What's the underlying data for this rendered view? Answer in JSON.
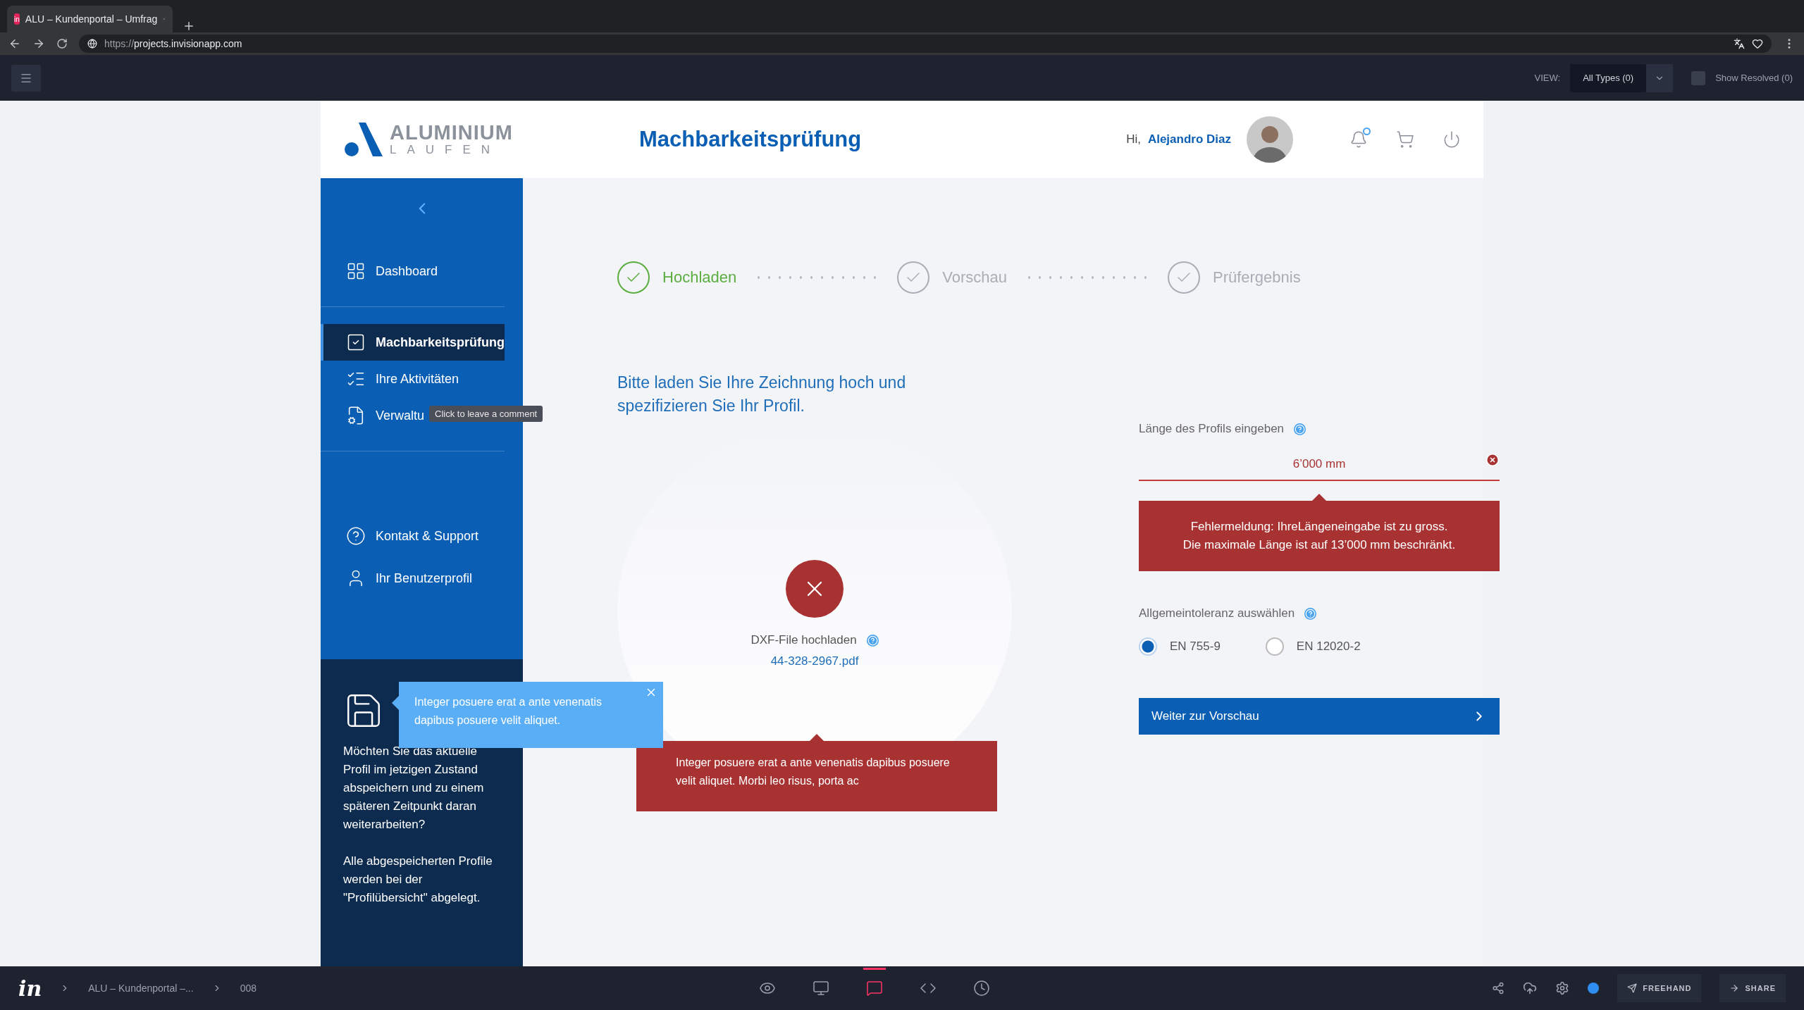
{
  "browser": {
    "favicon": "in",
    "tab_title": "ALU – Kundenportal – Umfrag",
    "url_scheme": "https://",
    "url_host": "projects.invisionapp.com"
  },
  "viewer_toolbar": {
    "view_label": "VIEW:",
    "view_value": "All Types (0)",
    "show_resolved": {
      "label": "Show Resolved (0)",
      "checked": false
    }
  },
  "header": {
    "logo_top": "ALUMINIUM",
    "logo_bottom": "LAUFEN",
    "title": "Machbarkeitsprüfung",
    "greeting": "Hi,",
    "user_name": "Alejandro Diaz",
    "notification_unread": true
  },
  "sidebar": {
    "main_items": [
      {
        "label": "Dashboard",
        "selected": false
      },
      {
        "label": "Machbarkeitsprüfung",
        "selected": true
      },
      {
        "label": "Ihre Aktivitäten",
        "selected": false
      },
      {
        "label": "Verwaltu",
        "selected": false
      }
    ],
    "comment_tooltip": "Click to leave a comment",
    "support_items": [
      {
        "label": "Kontakt & Support"
      },
      {
        "label": "Ihr Benutzerprofil"
      }
    ],
    "save_panel": {
      "popup": "Integer posuere erat a ante venenatis dapibus posuere velit aliquet.",
      "question": "Möchten Sie das aktuelle Profil im jetzigen Zustand abspeichern und zu einem späteren Zeitpunkt daran weiterarbeiten?",
      "note": "Alle abgespeicherten Profile werden bei der \"Profilübersicht\" abgelegt."
    }
  },
  "steps": [
    {
      "label": "Hochladen",
      "selected": true
    },
    {
      "label": "Vorschau",
      "selected": false
    },
    {
      "label": "Prüfergebnis",
      "selected": false
    }
  ],
  "intro": "Bitte laden Sie Ihre Zeichnung hoch und spezifizieren Sie Ihr Profil.",
  "upload": {
    "label": "DXF-File hochladen",
    "file_name": "44-328-2967.pdf",
    "error": "Integer posuere erat a ante venenatis dapibus posuere velit aliquet. Morbi leo risus, porta ac"
  },
  "length_field": {
    "label": "Länge des Profils eingeben",
    "value": "6’000 mm",
    "error_lines": [
      "Fehlermeldung: IhreLängeneingabe ist zu gross.",
      "Die maximale Länge ist auf 13’000 mm beschränkt."
    ]
  },
  "tolerance": {
    "label": "Allgemeintoleranz auswählen",
    "options": [
      {
        "label": "EN 755-9",
        "selected": true
      },
      {
        "label": "EN 12020-2",
        "selected": false
      }
    ]
  },
  "next_button": "Weiter zur Vorschau",
  "bottom_bar": {
    "logo": "in",
    "project": "ALU – Kundenportal –...",
    "screen": "008",
    "tools": [
      {
        "selected": false
      },
      {
        "selected": false
      },
      {
        "selected": true
      },
      {
        "selected": false
      },
      {
        "selected": false
      }
    ],
    "freehand": "FREEHAND",
    "share": "SHARE"
  }
}
